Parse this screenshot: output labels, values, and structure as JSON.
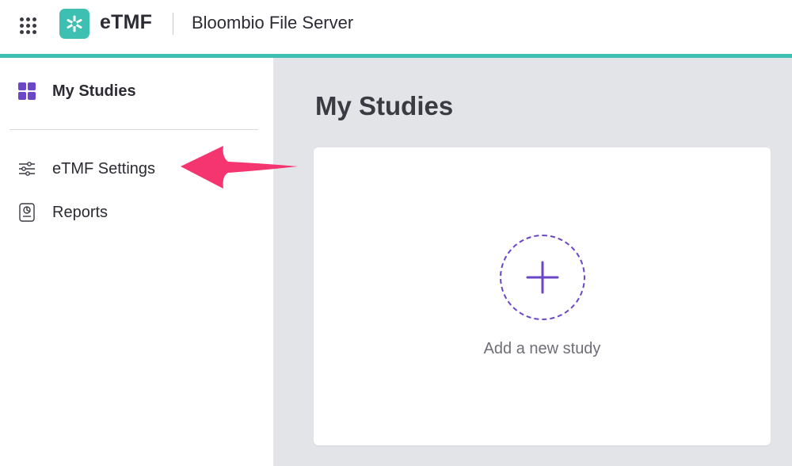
{
  "header": {
    "brand": "eTMF",
    "server_name": "Bloombio File Server"
  },
  "sidebar": {
    "items": [
      {
        "label": "My Studies",
        "icon": "grid-icon",
        "active": true
      },
      {
        "label": "eTMF Settings",
        "icon": "sliders-icon",
        "active": false
      },
      {
        "label": "Reports",
        "icon": "report-icon",
        "active": false
      }
    ]
  },
  "main": {
    "title": "My Studies",
    "add_study_label": "Add a new study"
  },
  "colors": {
    "accent_teal": "#3dbfb2",
    "accent_purple": "#6b46c7",
    "annotation_pink": "#f5356f",
    "main_background": "#e3e4e8"
  }
}
